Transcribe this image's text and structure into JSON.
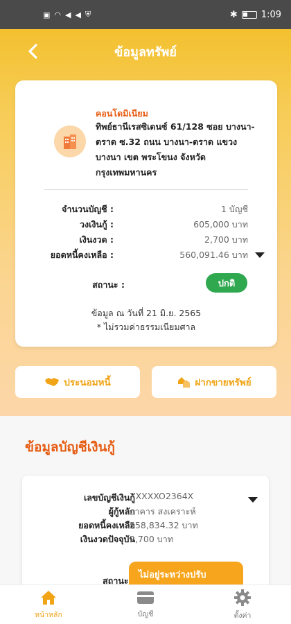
{
  "status_bar": {
    "time": "1:09"
  },
  "header": {
    "title": "ข้อมูลทรัพย์"
  },
  "property": {
    "type": "คอนโดมิเนียม",
    "address": "ทิพย์ธานีเรสซิเดนซ์ 61/128 ซอย บางนา-ตราด ซ.32 ถนน บางนา-ตราด แขวงบางนา เขต พระโขนง จังหวัดกรุงเทพมหานคร",
    "rows": [
      {
        "label": "จำนวนบัญชี :",
        "value": "1 บัญชี"
      },
      {
        "label": "วงเงินกู้ :",
        "value": "605,000 บาท"
      },
      {
        "label": "เงินงวด :",
        "value": "2,700 บาท"
      },
      {
        "label": "ยอดหนี้คงเหลือ :",
        "value": "560,091.46 บาท"
      }
    ],
    "status_label": "สถานะ :",
    "status_value": "ปกติ",
    "as_of": "ข้อมูล ณ วันที่ 21 มิ.ย. 2565",
    "note": "* ไม่รวมค่าธรรมเนียมศาล"
  },
  "actions": {
    "compromise": "ประนอมหนี้",
    "consign_sale": "ฝากขายทรัพย์"
  },
  "loan_section": {
    "title": "ข้อมูลบัญชีเงินกู้",
    "rows": [
      {
        "label": "เลขบัญชีเงินกู้",
        "value": "XXXXXO2364X"
      },
      {
        "label": "ผู้กู้หลัก",
        "value": "อาคาร สงเคราะห์"
      },
      {
        "label": "ยอดหนี้คงเหลือ",
        "value": "558,834.32 บาท"
      },
      {
        "label": "เงินงวดปัจจุบัน",
        "value": "2,700 บาท"
      }
    ],
    "status_label": "สถานะ :",
    "status_value": "ไม่อยู่ระหว่างปรับ"
  },
  "bottom_nav": [
    {
      "label": "หน้าหลัก",
      "icon": "home-icon",
      "active": true
    },
    {
      "label": "บัญชี",
      "icon": "card-icon",
      "active": false
    },
    {
      "label": "ตั้งค่า",
      "icon": "gear-icon",
      "active": false
    }
  ],
  "colors": {
    "accent_orange": "#e65c12",
    "accent_yellow": "#f0a416",
    "status_green": "#2fa84f",
    "status_amber": "#f7a51c"
  }
}
